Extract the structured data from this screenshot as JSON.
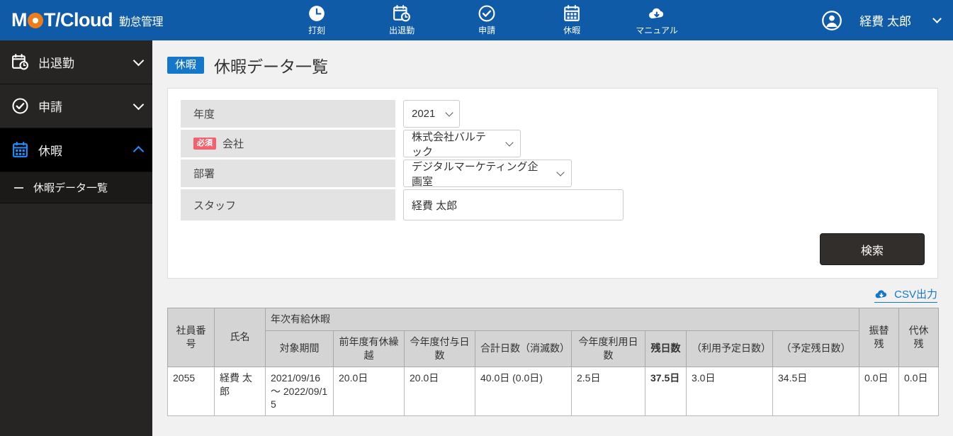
{
  "brand": {
    "logo_main": "M",
    "logo_o": "O",
    "logo_rest": "T/Cloud",
    "sub": "勤怠管理"
  },
  "topnav": [
    {
      "label": "打刻",
      "icon": "clock-icon"
    },
    {
      "label": "出退勤",
      "icon": "calendar-clock-icon"
    },
    {
      "label": "申請",
      "icon": "check-circle-icon"
    },
    {
      "label": "休暇",
      "icon": "calendar-grid-icon"
    },
    {
      "label": "マニュアル",
      "icon": "cloud-download-icon"
    }
  ],
  "user": {
    "name": "経費 太郎",
    "avatar": "user-avatar-icon"
  },
  "sidebar": {
    "items": [
      {
        "label": "出退勤",
        "icon": "calendar-clock-icon",
        "state": "collapsed",
        "active": false
      },
      {
        "label": "申請",
        "icon": "check-circle-icon",
        "state": "collapsed",
        "active": false
      },
      {
        "label": "休暇",
        "icon": "calendar-grid-icon",
        "state": "expanded",
        "active": true
      }
    ],
    "subitems": [
      {
        "label": "休暇データ一覧",
        "active": true
      }
    ]
  },
  "page": {
    "tag": "休暇",
    "title": "休暇データ一覧"
  },
  "search_form": {
    "rows": [
      {
        "label": "年度",
        "required": false,
        "control": "select",
        "value": "2021"
      },
      {
        "label": "会社",
        "required": true,
        "required_text": "必須",
        "control": "select",
        "value": "株式会社バルテック"
      },
      {
        "label": "部署",
        "required": false,
        "control": "select",
        "value": "デジタルマーケティング企画室"
      },
      {
        "label": "スタッフ",
        "required": false,
        "control": "text",
        "value": "経費 太郎",
        "placeholder": ""
      }
    ],
    "submit_label": "検索"
  },
  "csv_export": {
    "label": "CSV出力",
    "icon": "cloud-download-icon"
  },
  "table": {
    "group_header": "年次有給休暇",
    "headers_top": [
      "社員番号",
      "氏名",
      "年次有給休暇",
      "振替残",
      "代休残"
    ],
    "headers_sub": [
      "対象期間",
      "前年度有休繰越",
      "今年度付与日数",
      "合計日数（消滅数）",
      "今年度利用日数",
      "残日数",
      "（利用予定日数）",
      "（予定残日数）"
    ],
    "bold_headers": [
      "残日数"
    ],
    "rows": [
      {
        "employee_no": "2055",
        "name": "経費 太郎",
        "period": "2021/09/16 ～ 2022/09/15",
        "carryover": "20.0日",
        "granted": "20.0日",
        "total": "40.0日 (0.0日)",
        "used": "2.5日",
        "remaining": "37.5日",
        "planned_use": "3.0日",
        "planned_remaining": "34.5日",
        "substitute_remaining": "0.0日",
        "compensatory_remaining": "0.0日"
      }
    ]
  },
  "colors": {
    "header_blue": "#0f5ba8",
    "accent_blue": "#1477c9",
    "logo_orange": "#ef7c1b",
    "required_red": "#f4606c",
    "sidebar_bg": "#262523",
    "active_icon_blue": "#1e90ff"
  }
}
